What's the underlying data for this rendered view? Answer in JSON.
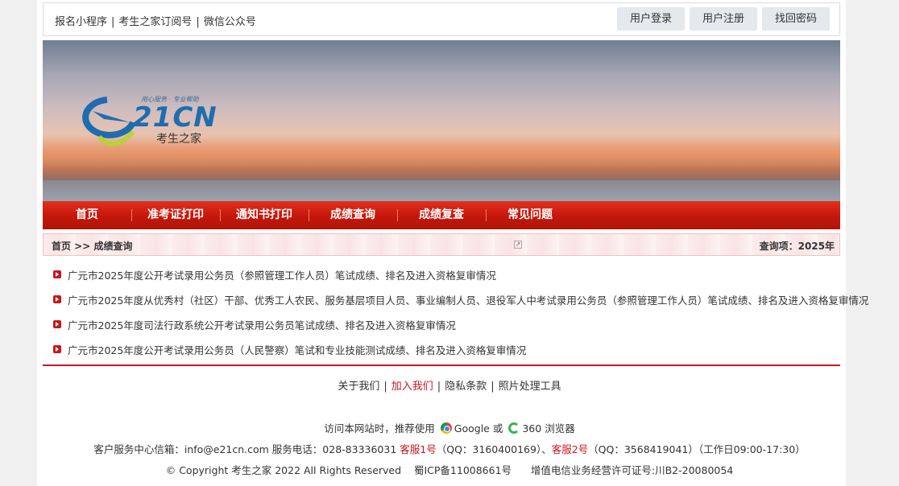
{
  "topbar": {
    "links": [
      "报名小程序",
      "考生之家订阅号",
      "微信公众号"
    ],
    "separator": "|",
    "buttons": {
      "login": "用户登录",
      "register": "用户注册",
      "recover": "找回密码"
    }
  },
  "banner": {
    "logo_tagline": "用心服务 · 专业帮助",
    "logo_mark": "21CN",
    "logo_name": "考生之家"
  },
  "nav": {
    "items": [
      "首页",
      "准考证打印",
      "通知书打印",
      "成绩查询",
      "成绩复查",
      "常见问题"
    ]
  },
  "breadcrumb": {
    "path": "首页 >> 成绩查询",
    "icon": "↗",
    "query_label": "查询项：2025年"
  },
  "results": [
    "广元市2025年度公开考试录用公务员（参照管理工作人员）笔试成绩、排名及进入资格复审情况",
    "广元市2025年度从优秀村（社区）干部、优秀工人农民、服务基层项目人员、事业编制人员、退役军人中考试录用公务员（参照管理工作人员）笔试成绩、排名及进入资格复审情况",
    "广元市2025年度司法行政系统公开考试录用公务员笔试成绩、排名及进入资格复审情况",
    "广元市2025年度公开考试录用公务员（人民警察）笔试和专业技能测试成绩、排名及进入资格复审情况"
  ],
  "footer": {
    "links": [
      "关于我们",
      "加入我们",
      "隐私条款",
      "照片处理工具"
    ],
    "separator": "|",
    "browser_prefix": "访问本网站时，推荐使用",
    "browser_google": "Google",
    "browser_or": "或",
    "browser_360": "360 浏览器",
    "service_prefix": "客户服务中心信箱：info@e21cn.com  服务电话：028-83336031",
    "kefu1": "客服1号",
    "kefu1_qq": "（QQ：3160400169）、",
    "kefu2": "客服2号",
    "kefu2_qq": "（QQ：3568419041）（工作日09:00-17:30）",
    "copyright": "© Copyright 考生之家 2022 All Rights Reserved",
    "icp": "蜀ICP备11008661号",
    "license": "增值电信业务经营许可证号:川B2-20080054"
  },
  "colors": {
    "nav_red": "#c4170b",
    "link_red": "#c8161d",
    "logo_blue": "#1f6db0"
  }
}
